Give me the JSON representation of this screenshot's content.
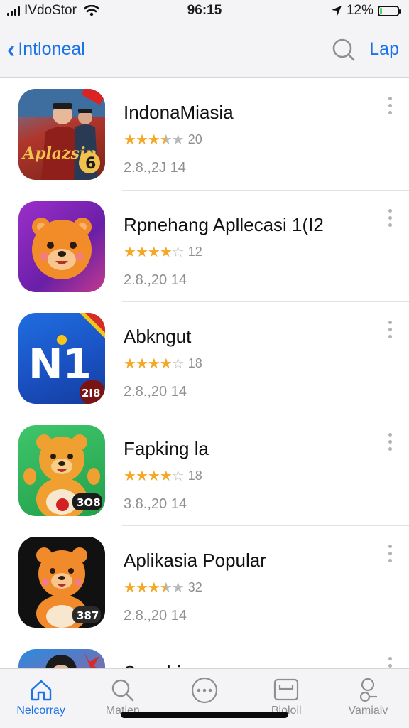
{
  "status_bar": {
    "carrier": "IVdoStor",
    "time": "96:15",
    "battery": "12%",
    "battery_level": 0.12
  },
  "nav": {
    "back_label": "Intloneal",
    "action_label": "Lap"
  },
  "apps": [
    {
      "title": "IndonaMiasia",
      "rating": 3.5,
      "count": "20",
      "meta": "2.8.,2J 14",
      "icon": "app-icon-poster",
      "badge": "6"
    },
    {
      "title": "Rpnehang Apllecasi 1(I2",
      "rating": 4,
      "count": "12",
      "meta": "2.8.,20 14",
      "icon": "bear-face-icon",
      "badge": ""
    },
    {
      "title": "Abkngut",
      "rating": 4,
      "count": "18",
      "meta": "2.8.,20 14",
      "icon": "n1-logo-icon",
      "badge": "2I8"
    },
    {
      "title": "Fapking la",
      "rating": 4,
      "count": "18",
      "meta": "3.8.,20 14",
      "icon": "bear-waving-icon",
      "badge": "3O8"
    },
    {
      "title": "Aplikasia Popular",
      "rating": 3.5,
      "count": "32",
      "meta": "2.8.,20 14",
      "icon": "bear-dark-icon",
      "badge": "387"
    },
    {
      "title": "Sanphine",
      "rating": 0,
      "count": "",
      "meta": "",
      "icon": "partial-app-icon",
      "badge": ""
    }
  ],
  "tabs": [
    {
      "label": "Nelcorray",
      "icon": "home-icon",
      "active": true
    },
    {
      "label": "Matien",
      "icon": "search-icon",
      "active": false
    },
    {
      "label": "",
      "icon": "more-circle-icon",
      "active": false
    },
    {
      "label": "Bloloil",
      "icon": "tray-icon",
      "active": false
    },
    {
      "label": "Vamiaiv",
      "icon": "person-icon",
      "active": false
    }
  ],
  "colors": {
    "accent": "#1a73e8",
    "star": "#f5a623",
    "star_empty": "#b9b9bd",
    "secondary_text": "#8e8e93"
  }
}
